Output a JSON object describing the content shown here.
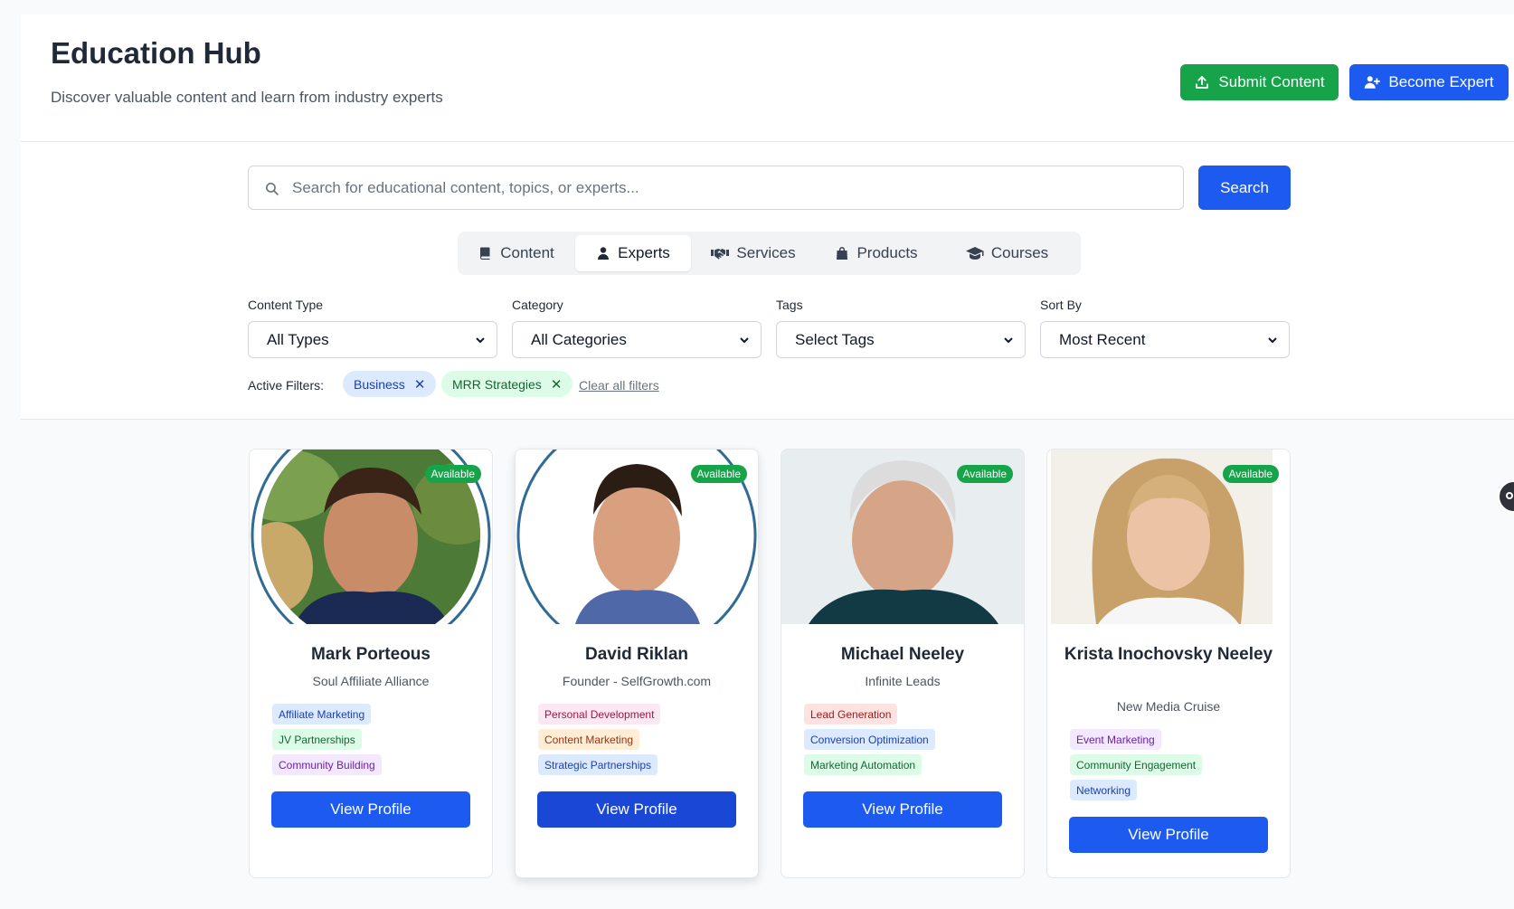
{
  "header": {
    "title": "Education Hub",
    "subtitle": "Discover valuable content and learn from industry experts",
    "submit_label": "Submit Content",
    "become_expert_label": "Become Expert"
  },
  "search": {
    "placeholder": "Search for educational content, topics, or experts...",
    "value": "",
    "button_label": "Search"
  },
  "tabs": [
    {
      "label": "Content",
      "icon": "book-icon",
      "active": false
    },
    {
      "label": "Experts",
      "icon": "user-icon",
      "active": true
    },
    {
      "label": "Services",
      "icon": "handshake-icon",
      "active": false
    },
    {
      "label": "Products",
      "icon": "shopping-bag-icon",
      "active": false
    },
    {
      "label": "Courses",
      "icon": "graduation-cap-icon",
      "active": false
    }
  ],
  "filters": {
    "content_type": {
      "label": "Content Type",
      "value": "All Types"
    },
    "category": {
      "label": "Category",
      "value": "All Categories"
    },
    "tags": {
      "label": "Tags",
      "value": "Select Tags"
    },
    "sort_by": {
      "label": "Sort By",
      "value": "Most Recent"
    }
  },
  "active_filters": {
    "label": "Active Filters:",
    "chips": [
      "Business",
      "MRR Strategies"
    ],
    "clear_label": "Clear all filters"
  },
  "experts": [
    {
      "name": "Mark Porteous",
      "org": "Soul Affiliate Alliance",
      "status": "Available",
      "tags": [
        "Affiliate Marketing",
        "JV Partnerships",
        "Community Building"
      ],
      "button_label": "View Profile"
    },
    {
      "name": "David Riklan",
      "org": "Founder - SelfGrowth.com",
      "status": "Available",
      "tags": [
        "Personal Development",
        "Content Marketing",
        "Strategic Partnerships"
      ],
      "button_label": "View Profile"
    },
    {
      "name": "Michael Neeley",
      "org": "Infinite Leads",
      "status": "Available",
      "tags": [
        "Lead Generation",
        "Conversion Optimization",
        "Marketing Automation"
      ],
      "button_label": "View Profile"
    },
    {
      "name": "Krista Inochovsky Neeley",
      "org": "New Media Cruise",
      "status": "Available",
      "tags": [
        "Event Marketing",
        "Community Engagement",
        "Networking"
      ],
      "button_label": "View Profile"
    }
  ],
  "colors": {
    "primary": "#1d5bf0",
    "success": "#16a34a",
    "available_badge": "#16a34a"
  }
}
